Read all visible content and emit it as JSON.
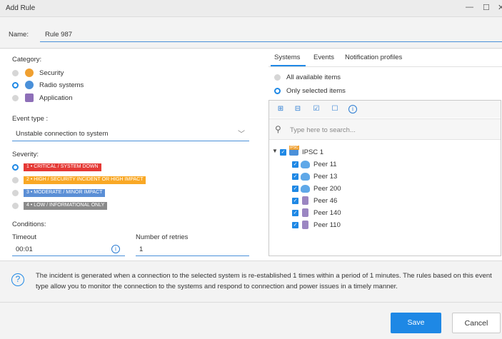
{
  "window": {
    "title": "Add Rule",
    "minimize": "—",
    "maximize": "☐",
    "close": "✕"
  },
  "name": {
    "label": "Name:",
    "value": "Rule 987"
  },
  "category": {
    "label": "Category:",
    "options": [
      {
        "label": "Security",
        "selected": false,
        "icon": "shield-icon",
        "color": "#f0a030"
      },
      {
        "label": "Radio systems",
        "selected": true,
        "icon": "radio-icon",
        "color": "#4a90d9"
      },
      {
        "label": "Application",
        "selected": false,
        "icon": "application-icon",
        "color": "#8e6fb8"
      }
    ]
  },
  "event_type": {
    "label": "Event type :",
    "value": "Unstable connection to system"
  },
  "severity": {
    "label": "Severity:",
    "options": [
      {
        "label": "1 • CRITICAL / SYSTEM DOWN",
        "color": "#e53935",
        "selected": true
      },
      {
        "label": "2 • HIGH / SECURITY INCIDENT OR HIGH IMPACT",
        "color": "#f9a825",
        "selected": false
      },
      {
        "label": "3 • MODERATE / MINOR IMPACT",
        "color": "#5b8fd6",
        "selected": false
      },
      {
        "label": "4 • LOW / INFORMATIONAL ONLY",
        "color": "#8a8a8a",
        "selected": false
      }
    ]
  },
  "conditions": {
    "label": "Conditions:",
    "timeout_label": "Timeout",
    "timeout_value": "00:01",
    "retries_label": "Number of retries",
    "retries_value": "1"
  },
  "tabs": [
    {
      "label": "Systems",
      "active": true
    },
    {
      "label": "Events",
      "active": false
    },
    {
      "label": "Notification profiles",
      "active": false
    }
  ],
  "scope": {
    "options": [
      {
        "label": "All available items",
        "selected": false
      },
      {
        "label": "Only selected items",
        "selected": true
      }
    ]
  },
  "tree": {
    "toolbar_icons": [
      "expand-all-icon",
      "collapse-all-icon",
      "check-all-icon",
      "uncheck-all-icon",
      "info-icon"
    ],
    "search_placeholder": "Type here to search...",
    "root": {
      "label": "IPSC 1",
      "badge": "IPSC",
      "expanded": true,
      "checked": true
    },
    "children": [
      {
        "label": "Peer 11",
        "checked": true,
        "icon": "peer-icon"
      },
      {
        "label": "Peer 13",
        "checked": true,
        "icon": "peer-icon"
      },
      {
        "label": "Peer 200",
        "checked": true,
        "icon": "peer-icon"
      },
      {
        "label": "Peer 46",
        "checked": true,
        "icon": "repeater-icon"
      },
      {
        "label": "Peer 140",
        "checked": true,
        "icon": "repeater-icon"
      },
      {
        "label": "Peer 110",
        "checked": true,
        "icon": "repeater-icon"
      }
    ]
  },
  "description": "The incident is generated when a connection to the selected system is re-established 1 times within a period of 1 minutes. The rules based on this event type allow you to monitor the connection to the systems and respond to connection and power issues in a timely manner.",
  "buttons": {
    "save": "Save",
    "cancel": "Cancel"
  }
}
